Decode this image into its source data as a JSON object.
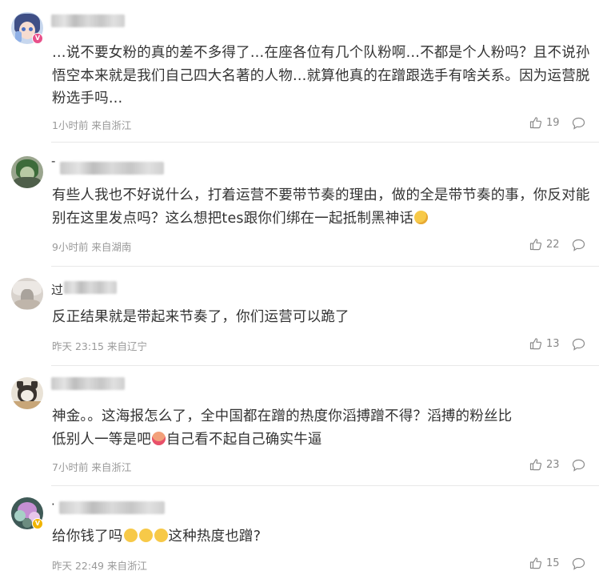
{
  "comments": [
    {
      "text": "…说不要女粉的真的差不多得了…在座各位有几个队粉啊…不都是个人粉吗？且不说孙悟空本来就是我们自己四大名著的人物…就算他真的在蹭跟选手有啥关系。因为运营脱粉选手吗…",
      "meta": "1小时前 来自浙江",
      "likes": "19",
      "avatar_icon": "anime-girl-avatar",
      "badge": "V",
      "badge_color": "#e8508a"
    },
    {
      "text": "有些人我也不好说什么，打着运营不要带节奏的理由，做的全是带节奏的事，你反对能别在这里发点吗？这么想把tes跟你们绑在一起抵制黑神话",
      "meta": "9小时前 来自湖南",
      "likes": "22",
      "avatar_icon": "green-character-avatar",
      "name_lead": "-",
      "emoji_after": "thinking-emoji"
    },
    {
      "text": "反正结果就是带起来节奏了，你们运营可以跪了",
      "meta": "昨天 23:15 来自辽宁",
      "likes": "13",
      "avatar_icon": "photo-avatar",
      "name_lead": "过"
    },
    {
      "text_line1": "神金。。这海报怎么了，全中国都在蹭的热度你滔搏蹭不得？滔搏的粉丝比",
      "text_line2a": "低别人一等是吧",
      "text_line2b": "自己看不起自己确实牛逼",
      "meta": "7小时前 来自浙江",
      "likes": "23",
      "avatar_icon": "cat-avatar"
    },
    {
      "text_a": "给你钱了吗",
      "text_b": "这种热度也蹭?",
      "meta": "昨天 22:49 来自浙江",
      "likes": "15",
      "avatar_icon": "flower-avatar",
      "badge": "V",
      "badge_color": "#f0b400",
      "name_lead": "·"
    }
  ],
  "colors": {
    "text": "#333333",
    "meta": "#999999",
    "divider": "#e8e8e8",
    "emoji_yellow": "#f7c948"
  },
  "icons": {
    "like": "thumbs-up-icon",
    "reply": "comment-bubble-icon"
  }
}
